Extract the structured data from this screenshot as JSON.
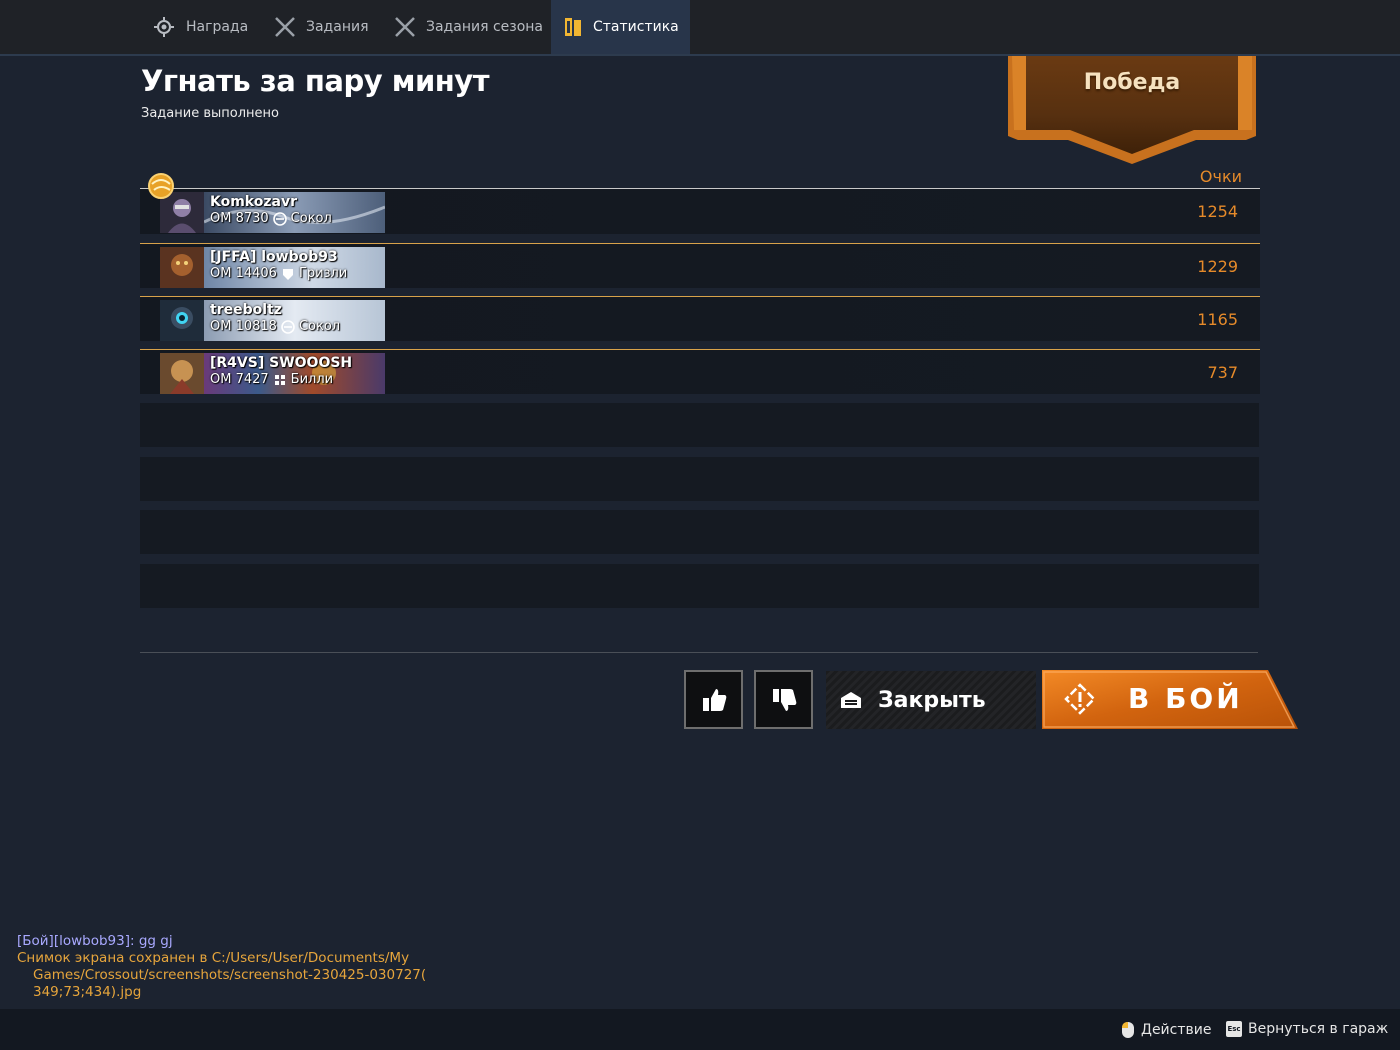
{
  "tabs": [
    {
      "label": "Награда",
      "icon": "reward-gear-icon",
      "active": false
    },
    {
      "label": "Задания",
      "icon": "crossed-swords-icon",
      "active": false
    },
    {
      "label": "Задания сезона",
      "icon": "crossed-swords-icon",
      "active": false
    },
    {
      "label": "Статистика",
      "icon": "stats-card-icon",
      "active": true
    }
  ],
  "mission": {
    "title": "Угнать за пару минут",
    "status": "Задание выполнено"
  },
  "result": {
    "label": "Победа"
  },
  "table": {
    "score_header": "Очки",
    "players": [
      {
        "name": "Komkozavr",
        "om_label": "ОМ 8730",
        "faction": "Сокол",
        "faction_icon": "falcon-icon",
        "score": "1254",
        "mvp": true
      },
      {
        "name": "[JFFA] lowbob93",
        "om_label": "ОМ 14406",
        "faction": "Гризли",
        "faction_icon": "grizzly-icon",
        "score": "1229",
        "mvp": false
      },
      {
        "name": "treeboltz",
        "om_label": "ОМ 10818",
        "faction": "Сокол",
        "faction_icon": "falcon-icon",
        "score": "1165",
        "mvp": false
      },
      {
        "name": "[R4VS] SWOOOSH",
        "om_label": "ОМ 7427",
        "faction": "Билли",
        "faction_icon": "billy-icon",
        "score": "737",
        "mvp": false
      }
    ]
  },
  "buttons": {
    "like": "thumbs-up-icon",
    "dislike": "thumbs-down-icon",
    "close": "Закрыть",
    "fight": "В БОЙ"
  },
  "chat": {
    "line1": "[Бой][lowbob93]: gg gj",
    "line2": "Снимок экрана сохранен в C:/Users/User/Documents/My",
    "line3": "Games/Crossout/screenshots/screenshot-230425-030727(",
    "line4": "349;73;434).jpg"
  },
  "footer": {
    "action_label": "Действие",
    "back_key": "Esc",
    "back_label": "Вернуться в гараж"
  },
  "colors": {
    "accent": "#e58a2a",
    "background": "#1c2330",
    "row_border": "#d8a24a"
  }
}
